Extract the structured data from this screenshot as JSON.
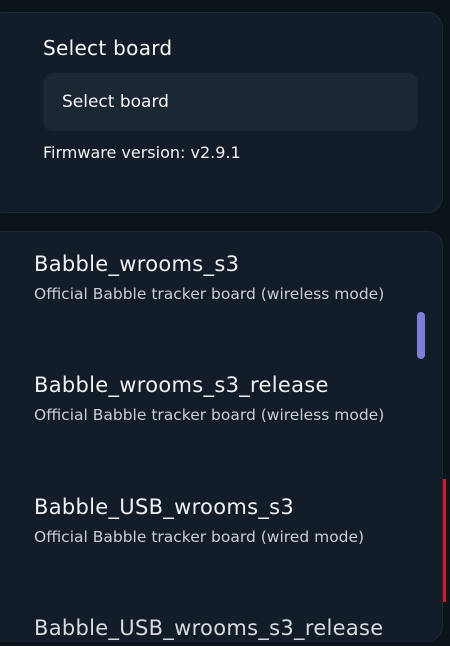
{
  "board_select": {
    "title": "Select board",
    "dropdown_value": "Select board",
    "firmware_version": "Firmware version: v2.9.1"
  },
  "boards": [
    {
      "name": "Babble_wrooms_s3",
      "description": "Official Babble tracker board (wireless mode)"
    },
    {
      "name": "Babble_wrooms_s3_release",
      "description": "Official Babble tracker board (wireless mode)"
    },
    {
      "name": "Babble_USB_wrooms_s3",
      "description": "Official Babble tracker board (wired mode)"
    },
    {
      "name": "Babble_USB_wrooms_s3_release",
      "description": ""
    }
  ],
  "colors": {
    "background": "#0c141b",
    "panel": "#121d27",
    "highlight_border": "#e0151d",
    "scrollbar": "#7a7fd9"
  }
}
